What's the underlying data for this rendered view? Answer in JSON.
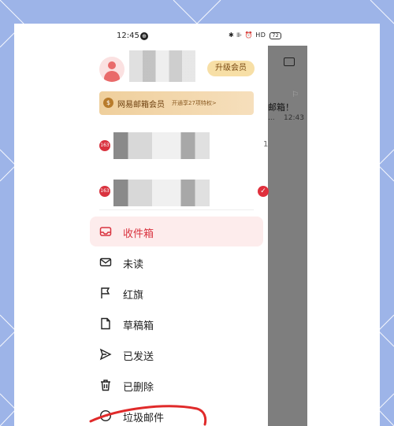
{
  "status_bar": {
    "time": "12:45",
    "notif_badge": "⊕",
    "right_icons": "✱ ⊪ ⏰ HD",
    "battery": "72"
  },
  "profile": {
    "upgrade_label": "升级会员",
    "vip_title": "网易邮箱会员",
    "vip_subtitle": "开通享27项特权>"
  },
  "accounts": [
    {
      "badge": "163",
      "count": "1",
      "selected": false
    },
    {
      "badge": "163",
      "count": "",
      "selected": true
    }
  ],
  "menu": [
    {
      "label": "收件箱",
      "icon": "inbox-icon",
      "active": true
    },
    {
      "label": "未读",
      "icon": "mail-icon",
      "active": false
    },
    {
      "label": "红旗",
      "icon": "flag-icon",
      "active": false
    },
    {
      "label": "草稿箱",
      "icon": "draft-icon",
      "active": false
    },
    {
      "label": "已发送",
      "icon": "send-icon",
      "active": false
    },
    {
      "label": "已删除",
      "icon": "trash-icon",
      "active": false
    },
    {
      "label": "垃圾邮件",
      "icon": "spam-icon",
      "active": false
    }
  ],
  "background_list": {
    "subject": "邮箱！",
    "ellipsis": "...",
    "time": "12:43"
  },
  "colors": {
    "accent": "#d9333f",
    "active_bg": "#fdecec",
    "vip_gold": "#efcf9c",
    "page_bg": "#9db4e8"
  }
}
